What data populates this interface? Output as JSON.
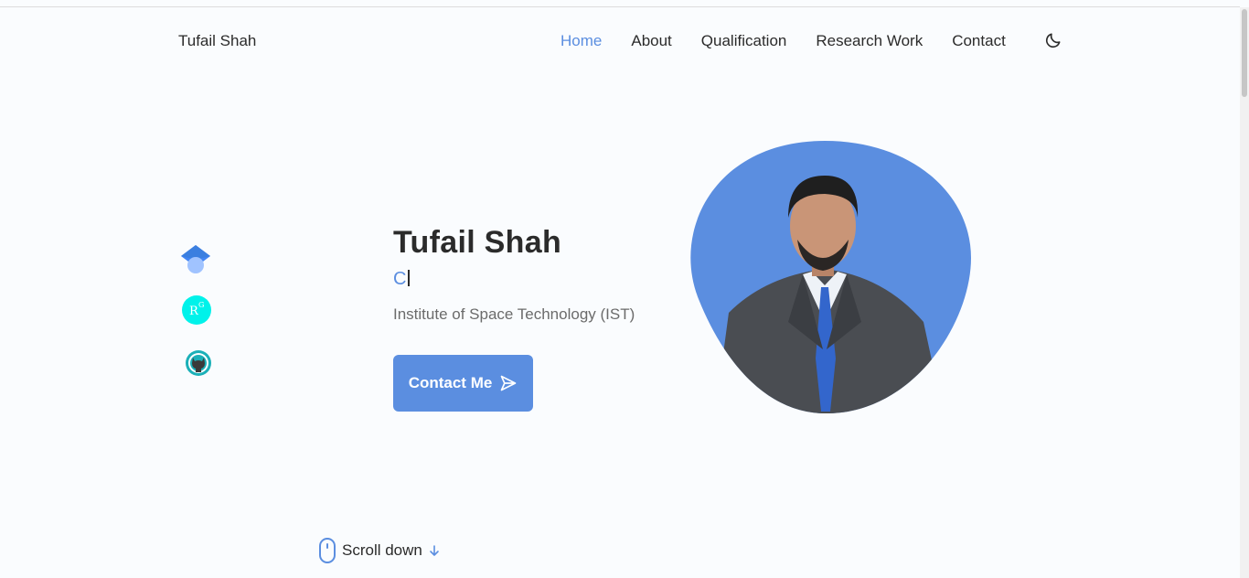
{
  "header": {
    "brand": "Tufail Shah",
    "nav": [
      {
        "label": "Home",
        "active": true
      },
      {
        "label": "About",
        "active": false
      },
      {
        "label": "Qualification",
        "active": false
      },
      {
        "label": "Research Work",
        "active": false
      },
      {
        "label": "Contact",
        "active": false
      }
    ],
    "theme_icon": "moon-icon"
  },
  "social": [
    {
      "icon": "google-scholar-icon"
    },
    {
      "icon": "researchgate-icon"
    },
    {
      "icon": "github-icon"
    }
  ],
  "hero": {
    "name": "Tufail Shah",
    "typed_text": "C",
    "subtitle": "Institute of Space Technology (IST)",
    "contact_button": "Contact Me",
    "photo_icon": "profile-photo"
  },
  "scroll": {
    "label": "Scroll down",
    "icon": "mouse-icon",
    "arrow_icon": "arrow-down-icon"
  },
  "colors": {
    "accent": "#5b8ee0",
    "background": "#fafcfe",
    "text": "#2b2b2b",
    "muted": "#6b6b6b"
  }
}
